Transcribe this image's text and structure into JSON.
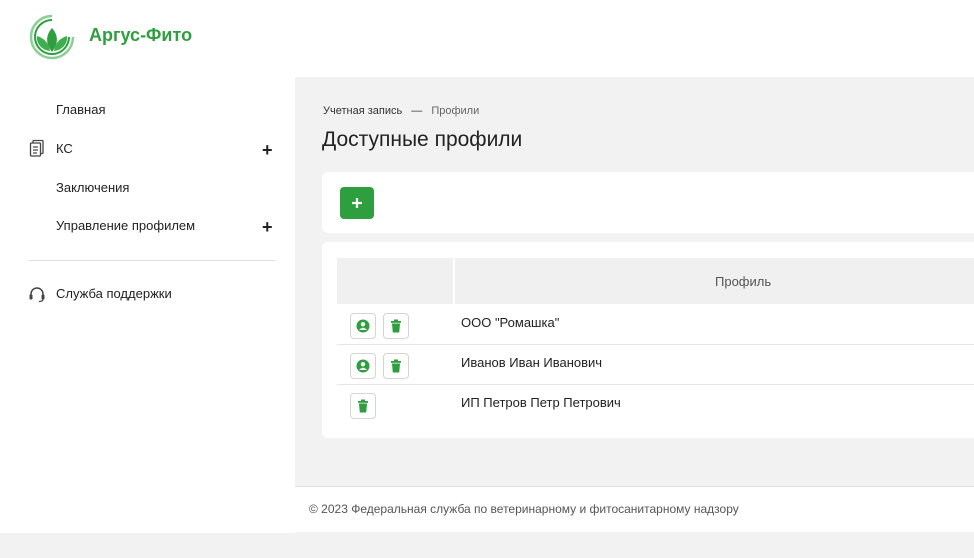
{
  "brand": {
    "name": "Аргус-Фито",
    "logo_icon": "leaf-logo-icon",
    "accent": "#2e9e3f"
  },
  "sidebar": {
    "items": [
      {
        "label": "Главная"
      },
      {
        "label": "КС",
        "icon": "document-icon",
        "expand": "+"
      },
      {
        "label": "Заключения"
      },
      {
        "label": "Управление профилем",
        "expand": "+"
      }
    ],
    "support": {
      "label": "Служба поддержки",
      "icon": "headset-icon"
    }
  },
  "breadcrumb": {
    "root": "Учетная запись",
    "separator": "—",
    "current": "Профили"
  },
  "page": {
    "title": "Доступные профили"
  },
  "toolbar": {
    "add_icon": "plus-icon"
  },
  "table": {
    "header": {
      "profile": "Профиль"
    },
    "rows": [
      {
        "name": "ООО \"Ромашка\"",
        "actions": [
          "user-icon",
          "trash-icon"
        ]
      },
      {
        "name": "Иванов Иван Иванович",
        "actions": [
          "user-icon",
          "trash-icon"
        ]
      },
      {
        "name": "ИП Петров Петр Петрович",
        "actions": [
          "trash-icon"
        ]
      }
    ]
  },
  "footer": {
    "text": "© 2023 Федеральная служба по ветеринарному и фитосанитарному надзору"
  }
}
